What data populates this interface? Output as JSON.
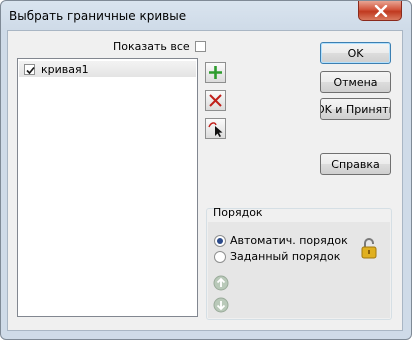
{
  "window": {
    "title": "Выбрать граничные кривые"
  },
  "show_all": {
    "label": "Показать все",
    "checked": false
  },
  "curves_list": {
    "items": [
      {
        "label": "кривая1",
        "checked": true
      }
    ]
  },
  "tools": {
    "add": "add-curve",
    "delete": "delete-curve",
    "pick": "pick-curve"
  },
  "buttons": {
    "ok": "OK",
    "cancel": "Отмена",
    "ok_apply": "OK и Принять",
    "help": "Справка"
  },
  "order": {
    "title": "Порядок",
    "options": [
      {
        "label": "Автоматич. порядок",
        "selected": true
      },
      {
        "label": "Заданный порядок",
        "selected": false
      }
    ]
  },
  "colors": {
    "add_icon": "#2e9c2e",
    "delete_icon": "#c0201a",
    "lock_icon": "#e0b020"
  }
}
